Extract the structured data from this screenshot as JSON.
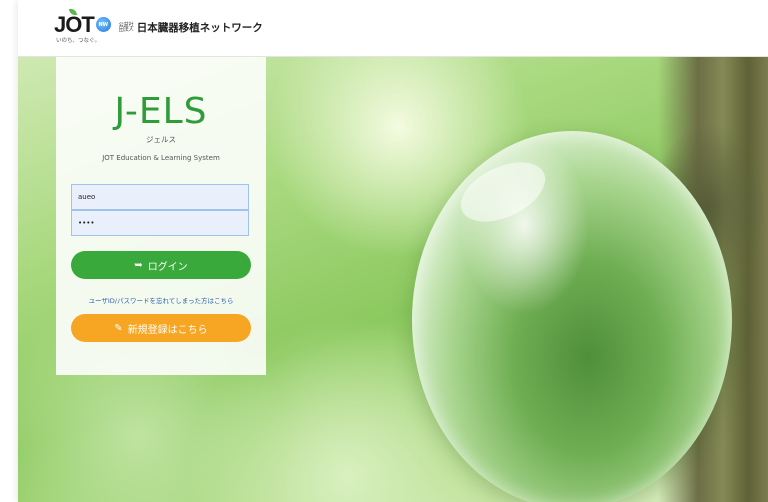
{
  "header": {
    "logo_text": "JOT",
    "logo_badge": "NW",
    "logo_tagline": "いのち、つなぐ。",
    "org_prefix": "公益社団法人",
    "org_name": "日本臓器移植ネットワーク"
  },
  "login": {
    "brand_title": "J-ELS",
    "brand_kana": "ジェルス",
    "brand_subtitle": "JOT Education & Learning System",
    "username_value": "aueo",
    "password_value": "••••",
    "login_button_label": "ログイン",
    "login_icon": "sign-in-icon",
    "forgot_link": "ユーザID/パスワードを忘れてしまった方はこちら",
    "register_button_label": "新規登録はこちら",
    "register_icon": "edit-icon"
  },
  "colors": {
    "brand_green": "#2f9c3a",
    "login_button": "#3aa93b",
    "register_button": "#f6a623",
    "link": "#2a5fb0"
  }
}
